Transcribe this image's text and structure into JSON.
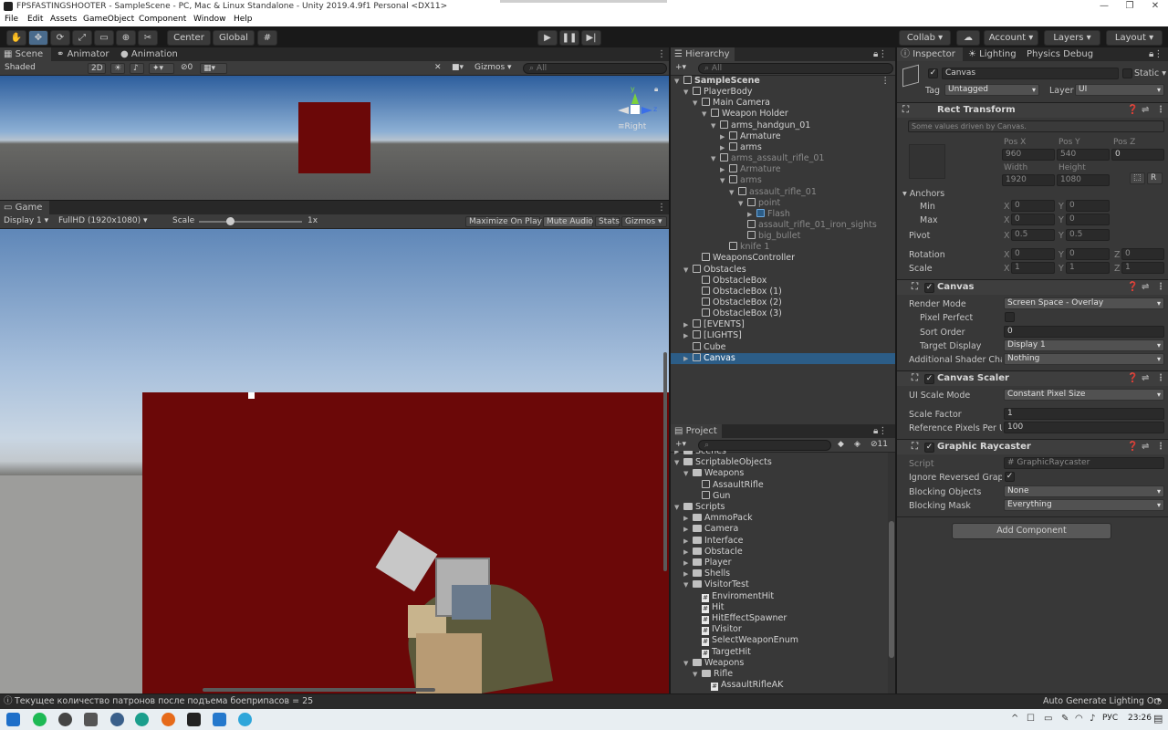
{
  "window": {
    "title": "FPSFASTINGSHOOTER - SampleScene - PC, Mac & Linux Standalone - Unity 2019.4.9f1 Personal <DX11>",
    "controls": [
      "—",
      "❐",
      "✕"
    ]
  },
  "menu": [
    "File",
    "Edit",
    "Assets",
    "GameObject",
    "Component",
    "Window",
    "Help"
  ],
  "toolbar": {
    "pivot": "Center",
    "space": "Global",
    "collab": "Collab",
    "account": "Account",
    "layers": "Layers",
    "layout": "Layout"
  },
  "scene_panel": {
    "tabs": [
      "Scene",
      "Animator",
      "Animation"
    ],
    "shading": "Shaded",
    "mode2d": "2D",
    "hidden_count": "0",
    "gizmos": "Gizmos",
    "search_placeholder": "All",
    "axis_right": "Right"
  },
  "game_panel": {
    "tab": "Game",
    "display": "Display 1",
    "resolution": "FullHD (1920x1080)",
    "scale_label": "Scale",
    "scale_value": "1x",
    "scale_fraction": 0.3,
    "maximize": "Maximize On Play",
    "mute": "Mute Audio",
    "stats": "Stats",
    "gizmos": "Gizmos"
  },
  "hierarchy": {
    "tab": "Hierarchy",
    "search_placeholder": "All",
    "items": [
      {
        "label": "SampleScene",
        "depth": 0,
        "kind": "scene",
        "arrow": "▼",
        "bold": true
      },
      {
        "label": "PlayerBody",
        "depth": 1,
        "kind": "cube",
        "arrow": "▼"
      },
      {
        "label": "Main Camera",
        "depth": 2,
        "kind": "cube",
        "arrow": "▼"
      },
      {
        "label": "Weapon Holder",
        "depth": 3,
        "kind": "cube",
        "arrow": "▼"
      },
      {
        "label": "arms_handgun_01",
        "depth": 4,
        "kind": "cube",
        "arrow": "▼"
      },
      {
        "label": "Armature",
        "depth": 5,
        "kind": "cube",
        "arrow": "▶"
      },
      {
        "label": "arms",
        "depth": 5,
        "kind": "cube",
        "arrow": "▶"
      },
      {
        "label": "arms_assault_rifle_01",
        "depth": 4,
        "kind": "cube",
        "arrow": "▼",
        "dim": true
      },
      {
        "label": "Armature",
        "depth": 5,
        "kind": "cube",
        "arrow": "▶",
        "dim": true
      },
      {
        "label": "arms",
        "depth": 5,
        "kind": "cube",
        "arrow": "▼",
        "dim": true
      },
      {
        "label": "assault_rifle_01",
        "depth": 6,
        "kind": "cube",
        "arrow": "▼",
        "dim": true
      },
      {
        "label": "point",
        "depth": 7,
        "kind": "cube",
        "arrow": "▼",
        "dim": true
      },
      {
        "label": "Flash",
        "depth": 8,
        "kind": "prefab",
        "arrow": "▶",
        "dim": true
      },
      {
        "label": "assault_rifle_01_iron_sights",
        "depth": 7,
        "kind": "cube",
        "arrow": "",
        "dim": true
      },
      {
        "label": "big_bullet",
        "depth": 7,
        "kind": "cube",
        "arrow": "",
        "dim": true
      },
      {
        "label": "knife 1",
        "depth": 5,
        "kind": "cube",
        "arrow": "",
        "dim": true
      },
      {
        "label": "WeaponsController",
        "depth": 2,
        "kind": "cube",
        "arrow": ""
      },
      {
        "label": "Obstacles",
        "depth": 1,
        "kind": "cube",
        "arrow": "▼"
      },
      {
        "label": "ObstacleBox",
        "depth": 2,
        "kind": "cube",
        "arrow": ""
      },
      {
        "label": "ObstacleBox (1)",
        "depth": 2,
        "kind": "cube",
        "arrow": ""
      },
      {
        "label": "ObstacleBox (2)",
        "depth": 2,
        "kind": "cube",
        "arrow": ""
      },
      {
        "label": "ObstacleBox (3)",
        "depth": 2,
        "kind": "cube",
        "arrow": ""
      },
      {
        "label": "[EVENTS]",
        "depth": 1,
        "kind": "cube",
        "arrow": "▶"
      },
      {
        "label": "[LIGHTS]",
        "depth": 1,
        "kind": "cube",
        "arrow": "▶"
      },
      {
        "label": "Cube",
        "depth": 1,
        "kind": "cube",
        "arrow": ""
      },
      {
        "label": "Canvas",
        "depth": 1,
        "kind": "cube",
        "arrow": "▶",
        "selected": true
      }
    ]
  },
  "project": {
    "tab": "Project",
    "hidden_count": "11",
    "items": [
      {
        "label": "Scenes",
        "depth": 0,
        "kind": "folder",
        "arrow": "▶"
      },
      {
        "label": "ScriptableObjects",
        "depth": 0,
        "kind": "folder",
        "arrow": "▼"
      },
      {
        "label": "Weapons",
        "depth": 1,
        "kind": "folder",
        "arrow": "▼"
      },
      {
        "label": "AssaultRifle",
        "depth": 2,
        "kind": "asset",
        "arrow": ""
      },
      {
        "label": "Gun",
        "depth": 2,
        "kind": "asset",
        "arrow": ""
      },
      {
        "label": "Scripts",
        "depth": 0,
        "kind": "folder",
        "arrow": "▼"
      },
      {
        "label": "AmmoPack",
        "depth": 1,
        "kind": "folder",
        "arrow": "▶"
      },
      {
        "label": "Camera",
        "depth": 1,
        "kind": "folder",
        "arrow": "▶"
      },
      {
        "label": "Interface",
        "depth": 1,
        "kind": "folder",
        "arrow": "▶"
      },
      {
        "label": "Obstacle",
        "depth": 1,
        "kind": "folder",
        "arrow": "▶"
      },
      {
        "label": "Player",
        "depth": 1,
        "kind": "folder",
        "arrow": "▶"
      },
      {
        "label": "Shells",
        "depth": 1,
        "kind": "folder",
        "arrow": "▶"
      },
      {
        "label": "VisitorTest",
        "depth": 1,
        "kind": "folder",
        "arrow": "▼"
      },
      {
        "label": "EnviromentHit",
        "depth": 2,
        "kind": "script",
        "arrow": ""
      },
      {
        "label": "Hit",
        "depth": 2,
        "kind": "script",
        "arrow": ""
      },
      {
        "label": "HitEffectSpawner",
        "depth": 2,
        "kind": "script",
        "arrow": ""
      },
      {
        "label": "IVisitor",
        "depth": 2,
        "kind": "script",
        "arrow": ""
      },
      {
        "label": "SelectWeaponEnum",
        "depth": 2,
        "kind": "script",
        "arrow": ""
      },
      {
        "label": "TargetHit",
        "depth": 2,
        "kind": "script",
        "arrow": ""
      },
      {
        "label": "Weapons",
        "depth": 1,
        "kind": "folder",
        "arrow": "▼"
      },
      {
        "label": "Rifle",
        "depth": 2,
        "kind": "folder",
        "arrow": "▼"
      },
      {
        "label": "AssaultRifleAK",
        "depth": 3,
        "kind": "script",
        "arrow": ""
      }
    ]
  },
  "inspector": {
    "tabs": [
      "Inspector",
      "Lighting",
      "Physics Debug"
    ],
    "object_name": "Canvas",
    "static_label": "Static",
    "tag_label": "Tag",
    "tag_value": "Untagged",
    "layer_label": "Layer",
    "layer_value": "UI",
    "rect_transform": {
      "title": "Rect Transform",
      "note": "Some values driven by Canvas.",
      "pos_x_label": "Pos X",
      "pos_y_label": "Pos Y",
      "pos_z_label": "Pos Z",
      "pos_x": "960",
      "pos_y": "540",
      "pos_z": "0",
      "width_label": "Width",
      "height_label": "Height",
      "width": "1920",
      "height": "1080",
      "r_button": "R",
      "anchors_label": "Anchors",
      "min_label": "Min",
      "max_label": "Max",
      "min_x": "0",
      "min_y": "0",
      "max_x": "0",
      "max_y": "0",
      "pivot_label": "Pivot",
      "pivot_x": "0.5",
      "pivot_y": "0.5",
      "rotation_label": "Rotation",
      "rot_x": "0",
      "rot_y": "0",
      "rot_z": "0",
      "scale_label": "Scale",
      "scale_x": "1",
      "scale_y": "1",
      "scale_z": "1",
      "x": "X",
      "y": "Y",
      "z": "Z"
    },
    "canvas": {
      "title": "Canvas",
      "render_mode_label": "Render Mode",
      "render_mode": "Screen Space - Overlay",
      "pixel_perfect_label": "Pixel Perfect",
      "sort_order_label": "Sort Order",
      "sort_order": "0",
      "target_display_label": "Target Display",
      "target_display": "Display 1",
      "shader_label": "Additional Shader Chann",
      "shader": "Nothing"
    },
    "canvas_scaler": {
      "title": "Canvas Scaler",
      "mode_label": "UI Scale Mode",
      "mode": "Constant Pixel Size",
      "factor_label": "Scale Factor",
      "factor": "1",
      "ref_label": "Reference Pixels Per Un",
      "ref": "100"
    },
    "raycaster": {
      "title": "Graphic Raycaster",
      "script_label": "Script",
      "script": "GraphicRaycaster",
      "ignore_label": "Ignore Reversed Graphic",
      "blocking_objects_label": "Blocking Objects",
      "blocking_objects": "None",
      "blocking_mask_label": "Blocking Mask",
      "blocking_mask": "Everything"
    },
    "add_component": "Add Component"
  },
  "status": {
    "message": "Текущее количество патронов после подъема боеприпасов = 25",
    "lighting": "Auto Generate Lighting On"
  },
  "taskbar": {
    "language": "РУС",
    "time": "23:26"
  },
  "colors": {
    "selection": "#2c5d87",
    "target_box": "#6b0808",
    "panel": "#383838"
  }
}
